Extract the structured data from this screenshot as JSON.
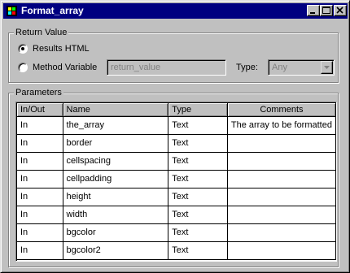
{
  "window": {
    "title": "Format_array",
    "icon": "app-icon",
    "buttons": [
      "minimize-icon",
      "maximize-icon",
      "close-icon"
    ]
  },
  "return_value": {
    "group_label": "Return Value",
    "options": [
      {
        "label": "Results HTML",
        "selected": true
      },
      {
        "label": "Method Variable",
        "selected": false
      }
    ],
    "variable_field": {
      "value": "return_value",
      "enabled": false
    },
    "type_label": "Type:",
    "type_select": {
      "value": "Any",
      "enabled": false
    }
  },
  "parameters": {
    "group_label": "Parameters",
    "columns": [
      "In/Out",
      "Name",
      "Type",
      "Comments"
    ],
    "rows": [
      [
        "In",
        "the_array",
        "Text",
        "The array to be formatted"
      ],
      [
        "In",
        "border",
        "Text",
        ""
      ],
      [
        "In",
        "cellspacing",
        "Text",
        ""
      ],
      [
        "In",
        "cellpadding",
        "Text",
        ""
      ],
      [
        "In",
        "height",
        "Text",
        ""
      ],
      [
        "In",
        "width",
        "Text",
        ""
      ],
      [
        "In",
        "bgcolor",
        "Text",
        ""
      ],
      [
        "In",
        "bgcolor2",
        "Text",
        ""
      ]
    ]
  },
  "colors": {
    "titlebar": "#000080",
    "face": "#c0c0c0",
    "disabled_text": "#808080"
  }
}
